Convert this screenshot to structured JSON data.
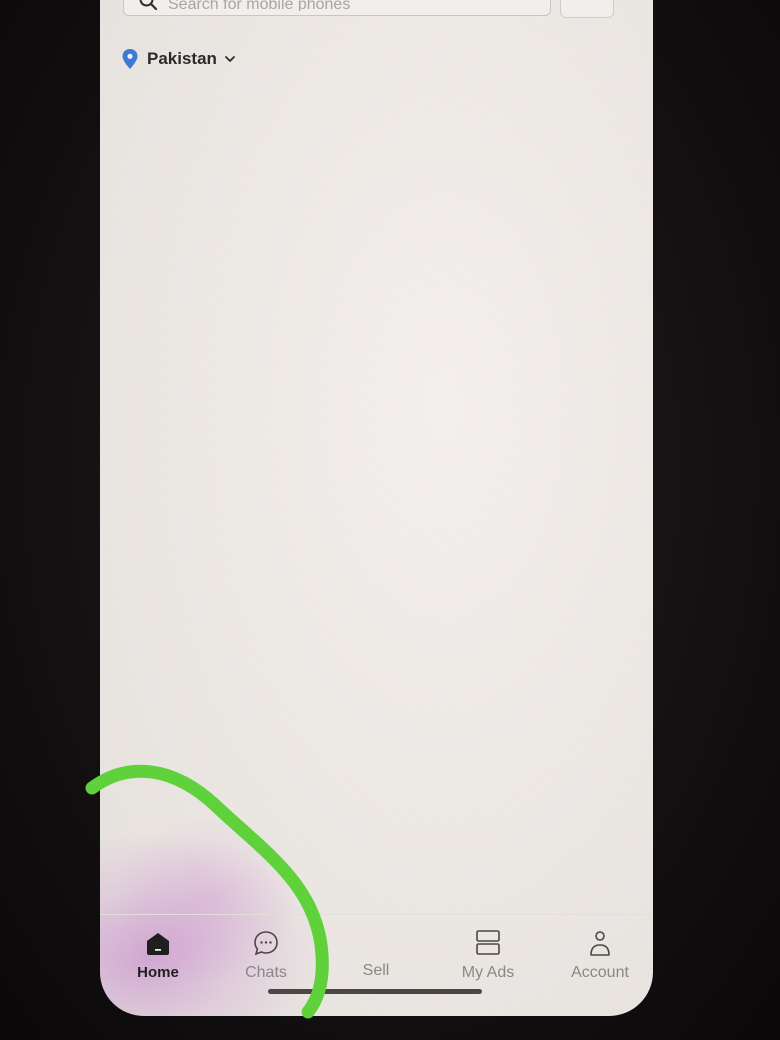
{
  "search": {
    "placeholder": "Search for mobile phones"
  },
  "location": {
    "label": "Pakistan",
    "pin_icon": "map-pin-icon",
    "chevron_icon": "chevron-down-icon",
    "pin_color": "#3b7bd4"
  },
  "bottom_nav": {
    "items": [
      {
        "label": "Home",
        "icon": "home-icon",
        "active": true
      },
      {
        "label": "Chats",
        "icon": "chat-bubble-icon",
        "active": false
      },
      {
        "label": "Sell",
        "icon": "sell-icon",
        "active": false
      },
      {
        "label": "My Ads",
        "icon": "my-ads-icon",
        "active": false
      },
      {
        "label": "Account",
        "icon": "person-icon",
        "active": false
      }
    ]
  },
  "annotation": {
    "color": "#5fd13a"
  }
}
